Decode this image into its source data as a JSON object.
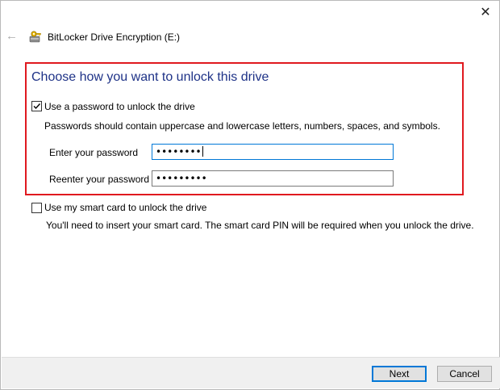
{
  "window": {
    "title": "BitLocker Drive Encryption (E:)",
    "close_glyph": "✕",
    "back_glyph": "←"
  },
  "heading": "Choose how you want to unlock this drive",
  "password_option": {
    "label": "Use a password to unlock the drive",
    "checked": true,
    "description": "Passwords should contain uppercase and lowercase letters, numbers, spaces, and symbols.",
    "enter_label": "Enter your password",
    "enter_value": "••••••••",
    "reenter_label": "Reenter your password",
    "reenter_value": "•••••••••"
  },
  "smartcard_option": {
    "label": "Use my smart card to unlock the drive",
    "checked": false,
    "description": "You'll need to insert your smart card. The smart card PIN will be required when you unlock the drive."
  },
  "footer": {
    "next_label": "Next",
    "cancel_label": "Cancel"
  },
  "colors": {
    "heading": "#1e3287",
    "highlight": "#e0191f",
    "accent": "#0078d7"
  },
  "icons": {
    "app": "bitlocker-key-drive-icon",
    "back": "back-arrow-icon",
    "close": "close-icon",
    "check": "checkmark-icon"
  }
}
